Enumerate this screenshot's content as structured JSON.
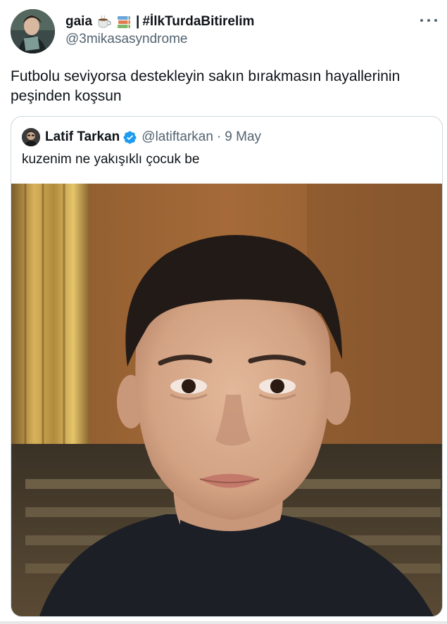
{
  "author": {
    "display_name": "gaia",
    "emoji_icons": [
      "hot-beverage-icon",
      "books-icon"
    ],
    "separator": "|",
    "hashtag": "#İlkTurdaBitirelim",
    "handle": "@3mikasasyndrome",
    "avatar_icon": "profile-avatar"
  },
  "tweet": {
    "text": "Futbolu seviyorsa destekleyin sakın bırakmasın hayallerinin peşinden koşsun"
  },
  "quoted_tweet": {
    "author_name": "Latif Tarkan",
    "verified_icon": "verified-badge-icon",
    "handle": "@latiftarkan",
    "separator": "·",
    "date": "9 May",
    "text": "kuzenim ne yakışıklı çocuk be",
    "media_description_icon": "portrait-photo"
  },
  "colors": {
    "text_primary": "#0f1419",
    "text_secondary": "#536471",
    "border": "#cfd9de",
    "verified_blue": "#1d9bf0"
  }
}
